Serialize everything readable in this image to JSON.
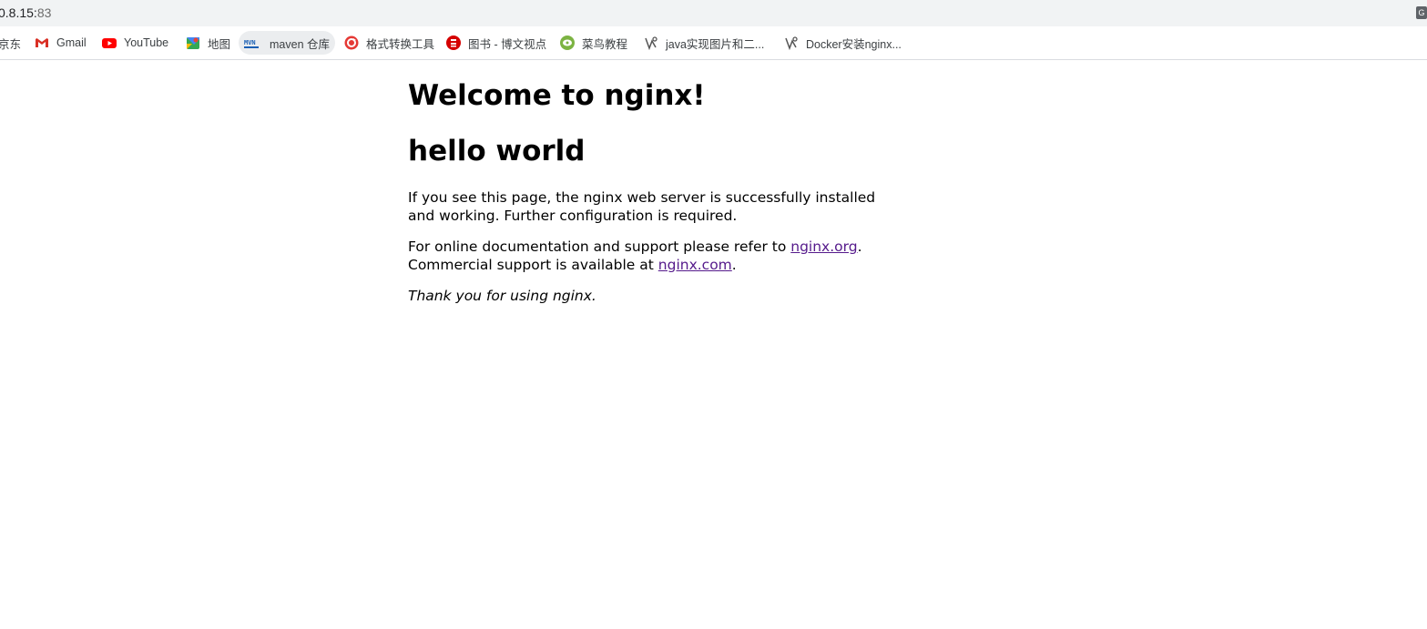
{
  "browser": {
    "url_host": "0.8.15:",
    "url_port": "83"
  },
  "bookmarks": [
    {
      "label": "京东",
      "icon": "jd-icon"
    },
    {
      "label": "Gmail",
      "icon": "gmail-icon"
    },
    {
      "label": "YouTube",
      "icon": "youtube-icon"
    },
    {
      "label": "地图",
      "icon": "maps-icon"
    },
    {
      "label": "maven 仓库",
      "icon": "mvn-icon"
    },
    {
      "label": "格式转换工具",
      "icon": "convert-icon"
    },
    {
      "label": "图书 - 博文视点",
      "icon": "broadview-icon"
    },
    {
      "label": "菜鸟教程",
      "icon": "runoob-icon"
    },
    {
      "label": "java实现图片和二...",
      "icon": "page-icon"
    },
    {
      "label": "Docker安装nginx...",
      "icon": "page-icon"
    }
  ],
  "page": {
    "heading": "Welcome to nginx!",
    "subheading": "hello world",
    "para1": "If you see this page, the nginx web server is successfully installed and working. Further configuration is required.",
    "para2_prefix": "For online documentation and support please refer to ",
    "link_org": "nginx.org",
    "para2_mid": ".",
    "para2_line2": "Commercial support is available at ",
    "link_com": "nginx.com",
    "para2_end": ".",
    "thanks": "Thank you for using nginx."
  }
}
